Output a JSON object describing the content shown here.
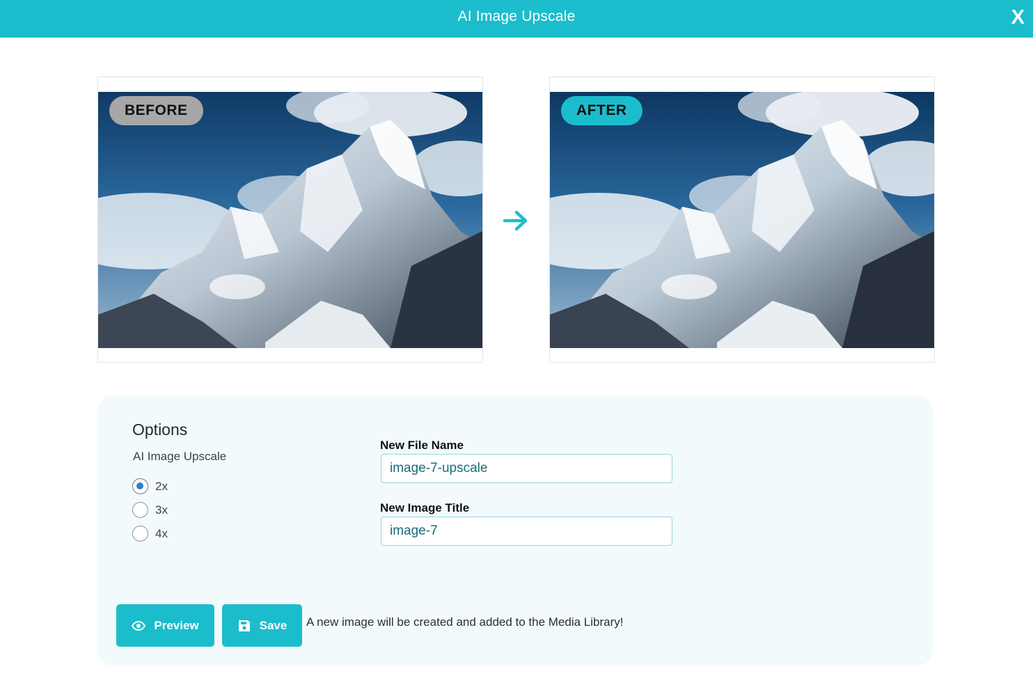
{
  "header": {
    "title": "AI Image Upscale",
    "close_label": "X"
  },
  "before": {
    "badge": "BEFORE"
  },
  "after": {
    "badge": "AFTER"
  },
  "options": {
    "title": "Options",
    "subtitle": "AI Image Upscale",
    "scales": [
      {
        "label": "2x",
        "checked": true
      },
      {
        "label": "3x",
        "checked": false
      },
      {
        "label": "4x",
        "checked": false
      }
    ]
  },
  "fields": {
    "file_name": {
      "label": "New File Name",
      "value": "image-7-upscale"
    },
    "image_title": {
      "label": "New Image Title",
      "value": "image-7"
    }
  },
  "actions": {
    "preview_label": "Preview",
    "save_label": "Save",
    "note": "A new image will be created and added to the Media Library!"
  },
  "colors": {
    "accent": "#1bbdcc",
    "badge_gray": "#a7a7a7",
    "radio_checked": "#2f7fd3"
  }
}
